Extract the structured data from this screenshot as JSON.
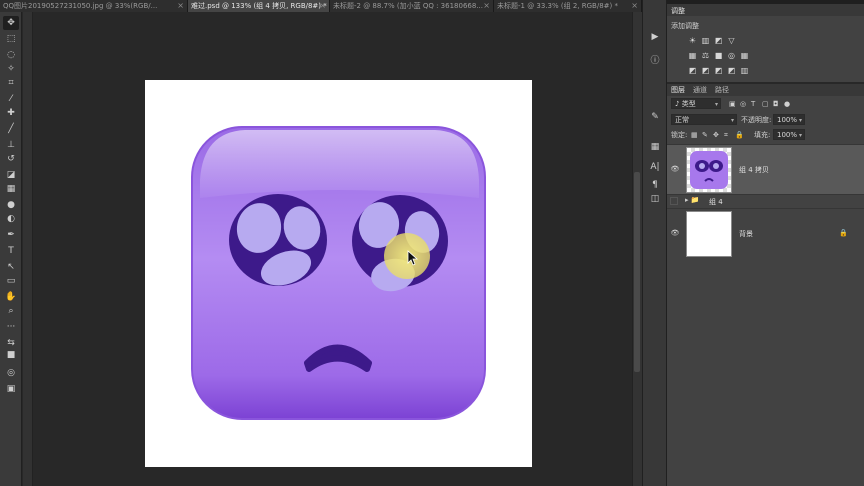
{
  "tabs": [
    {
      "label": "QQ图片20190527231050.jpg @ 33%(RGB/...",
      "active": false
    },
    {
      "label": "难过.psd @ 133% (组 4 拷贝, RGB/8#) *",
      "active": true
    },
    {
      "label": "未标题-2 @ 88.7% (加小蓝 QQ : 36180668...",
      "active": false
    },
    {
      "label": "未标题-1 @ 33.3% (组 2, RGB/8#) *",
      "active": false
    }
  ],
  "tab_close": "×",
  "toolbar": {
    "icons": [
      "move-icon",
      "marquee-icon",
      "lasso-icon",
      "magic-wand-icon",
      "crop-icon",
      "eyedropper-icon",
      "healing-icon",
      "brush-icon",
      "stamp-icon",
      "history-brush-icon",
      "eraser-icon",
      "gradient-icon",
      "blur-icon",
      "dodge-icon",
      "pen-icon",
      "type-icon",
      "path-select-icon",
      "shape-icon",
      "hand-icon",
      "zoom-icon",
      "more-icon",
      "swap-colors-icon",
      "color-swatch-icon",
      "quick-mask-icon",
      "screen-mode-icon"
    ],
    "glyphs": [
      "✥",
      "⬚",
      "◌",
      "✧",
      "⌗",
      "⁄",
      "✚",
      "╱",
      "⊥",
      "↺",
      "◪",
      "▦",
      "●",
      "◐",
      "✒",
      "T",
      "↖",
      "▭",
      "✋",
      "⌕",
      "···",
      "⇆",
      "■",
      "◎",
      "▣"
    ]
  },
  "side_strip": {
    "icons": [
      "play-icon",
      "info-icon",
      "brush-settings-icon",
      "swatches-icon",
      "character-icon",
      "paragraph-icon",
      "properties-icon"
    ],
    "glyphs": [
      "▶",
      "ⓘ",
      "✎",
      "▦",
      "A|",
      "¶",
      "◫"
    ]
  },
  "adjustments": {
    "title": "调整",
    "subtitle": "添加调整",
    "row1_icons": [
      "☀",
      "▥",
      "◩",
      "▽"
    ],
    "row2_icons": [
      "▦",
      "⚖",
      "■",
      "◎",
      "▦"
    ],
    "row3_icons": [
      "◩",
      "◩",
      "◩",
      "◩",
      "▥"
    ]
  },
  "layers_panel": {
    "tabs": [
      "图层",
      "通道",
      "路径"
    ],
    "filter_label": "♪ 类型",
    "filter_icons": [
      "▣",
      "◎",
      "T",
      "▢",
      "◘",
      "●"
    ],
    "blend_mode": "正常",
    "opacity_label": "不透明度:",
    "opacity_value": "100%",
    "lock_label": "锁定:",
    "lock_icons": [
      "▦",
      "✎",
      "✥",
      "⌗",
      "🔒"
    ],
    "fill_label": "填充:",
    "fill_value": "100%",
    "layers": [
      {
        "name": "组 4 拷贝",
        "visible": true,
        "selected": true
      },
      {
        "name": "组 4",
        "visible": false,
        "selected": false
      },
      {
        "name": "背景",
        "visible": true,
        "selected": false,
        "locked": true
      }
    ],
    "eye_glyph": "👁",
    "folder_glyph": "▸ 📁",
    "lock_glyph": "🔒"
  },
  "colors": {
    "purple_light": "#b98cf0",
    "purple_dark": "#7a3fd0",
    "eye_socket": "#3d1a8a",
    "pupil": "#b7aaf0",
    "cursor_highlight": "#f2ea80"
  }
}
